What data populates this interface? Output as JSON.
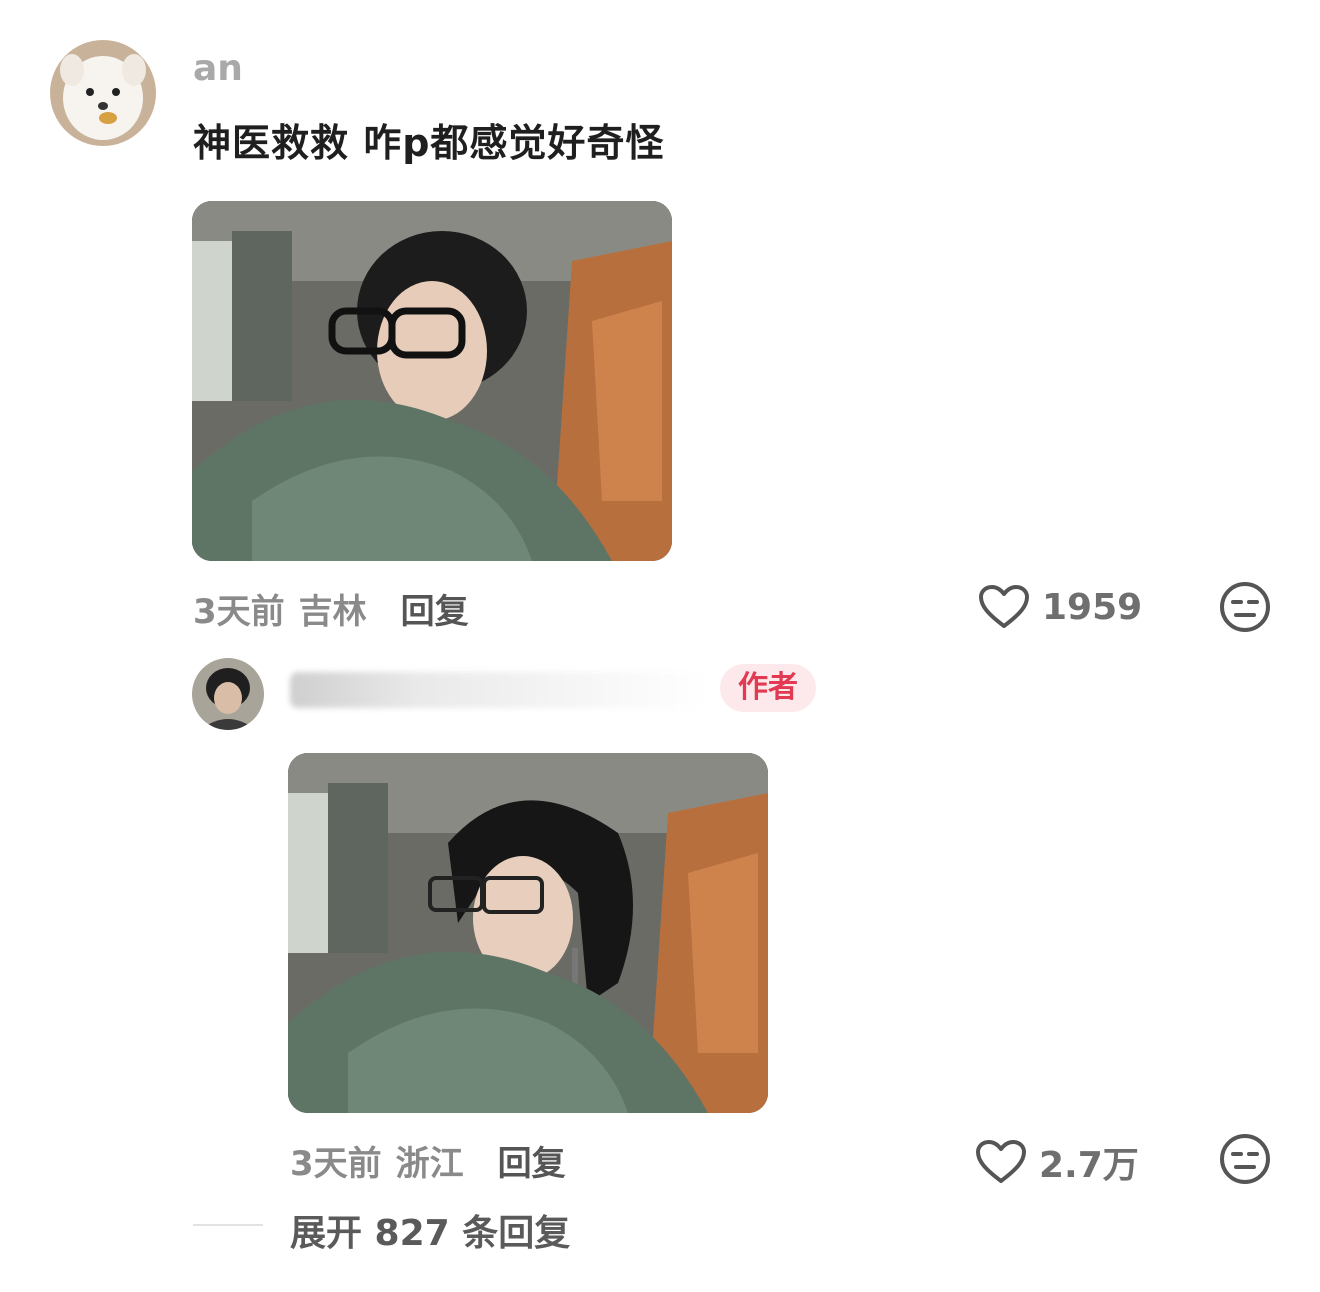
{
  "comment": {
    "username": "an",
    "text": "神医救救 咋p都感觉好奇怪",
    "time": "3天前",
    "location": "吉林",
    "reply_label": "回复",
    "like_count": "1959",
    "avatar_icon": "puppy-avatar"
  },
  "reply": {
    "badge": "作者",
    "time": "3天前",
    "location": "浙江",
    "reply_label": "回复",
    "like_count": "2.7万",
    "avatar_icon": "person-avatar"
  },
  "expand_label": "展开 827 条回复",
  "colors": {
    "badge_bg": "#fde8ec",
    "badge_text": "#e23a52",
    "meta_text": "#8a8a8a"
  }
}
